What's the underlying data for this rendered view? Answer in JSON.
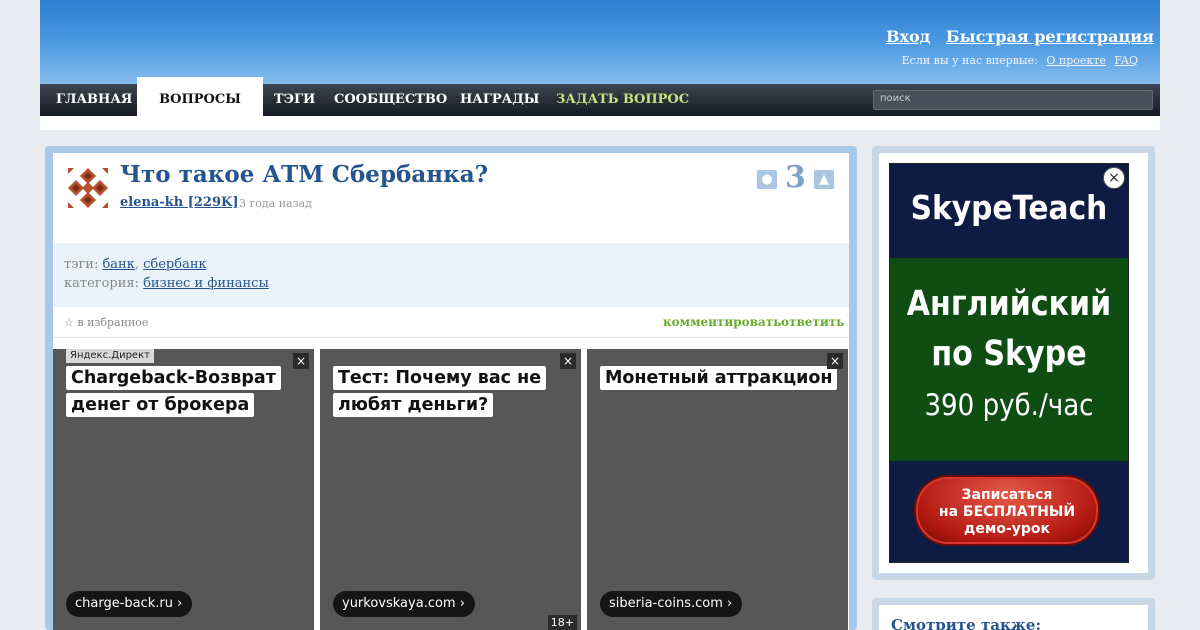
{
  "header": {
    "login": "Вход",
    "register": "Быстрая регистрация",
    "first_visit": "Если вы у нас впервые:",
    "about": "О проекте",
    "faq": "FAQ"
  },
  "nav": {
    "items": [
      {
        "label": "ГЛАВНАЯ"
      },
      {
        "label": "ВОПРОСЫ",
        "active": true
      },
      {
        "label": "ТЭГИ"
      },
      {
        "label": "СООБЩЕСТВО"
      },
      {
        "label": "НАГРАДЫ"
      },
      {
        "label": "ЗАДАТЬ ВОПРОС"
      }
    ],
    "search_placeholder": "поиск"
  },
  "question": {
    "title": "Что такое АТМ Сбербанка?",
    "author": "elena-kh [229K]",
    "time_ago": "3 года назад",
    "answers_count": "3",
    "tags_label": "тэги:",
    "tags": [
      "банк",
      "сбербанк"
    ],
    "tag_separator": ",",
    "category_label": "категория:",
    "category": "бизнес и финансы",
    "favorite": "в избранное",
    "comment": "комментировать",
    "answer": "ответить"
  },
  "ads": {
    "label": "Яндекс.Директ",
    "close_icon": "×",
    "items": [
      {
        "headline": "Chargeback-Возврат денег от брокера",
        "domain": "charge-back.ru"
      },
      {
        "headline": "Тест: Почему вас не любят деньги?",
        "domain": "yurkovskaya.com",
        "age": "18+"
      },
      {
        "headline": "Монетный аттракцион",
        "domain": "siberia-coins.com"
      }
    ]
  },
  "banner": {
    "brand": "SkypeTeach",
    "line1": "Английский",
    "line2": "по Skype",
    "price": "390 руб./час",
    "cta_line1": "Записаться",
    "cta_line2": "на БЕСПЛАТНЫЙ",
    "cta_line3": "демо-урок",
    "close_icon": "×"
  },
  "sidebar": {
    "see_also": "Смотрите также:"
  },
  "colors": {
    "header_blue": "#2d7fcf",
    "link_blue": "#24558f",
    "action_green": "#6aab2d",
    "ask_green": "#c7e27f"
  }
}
